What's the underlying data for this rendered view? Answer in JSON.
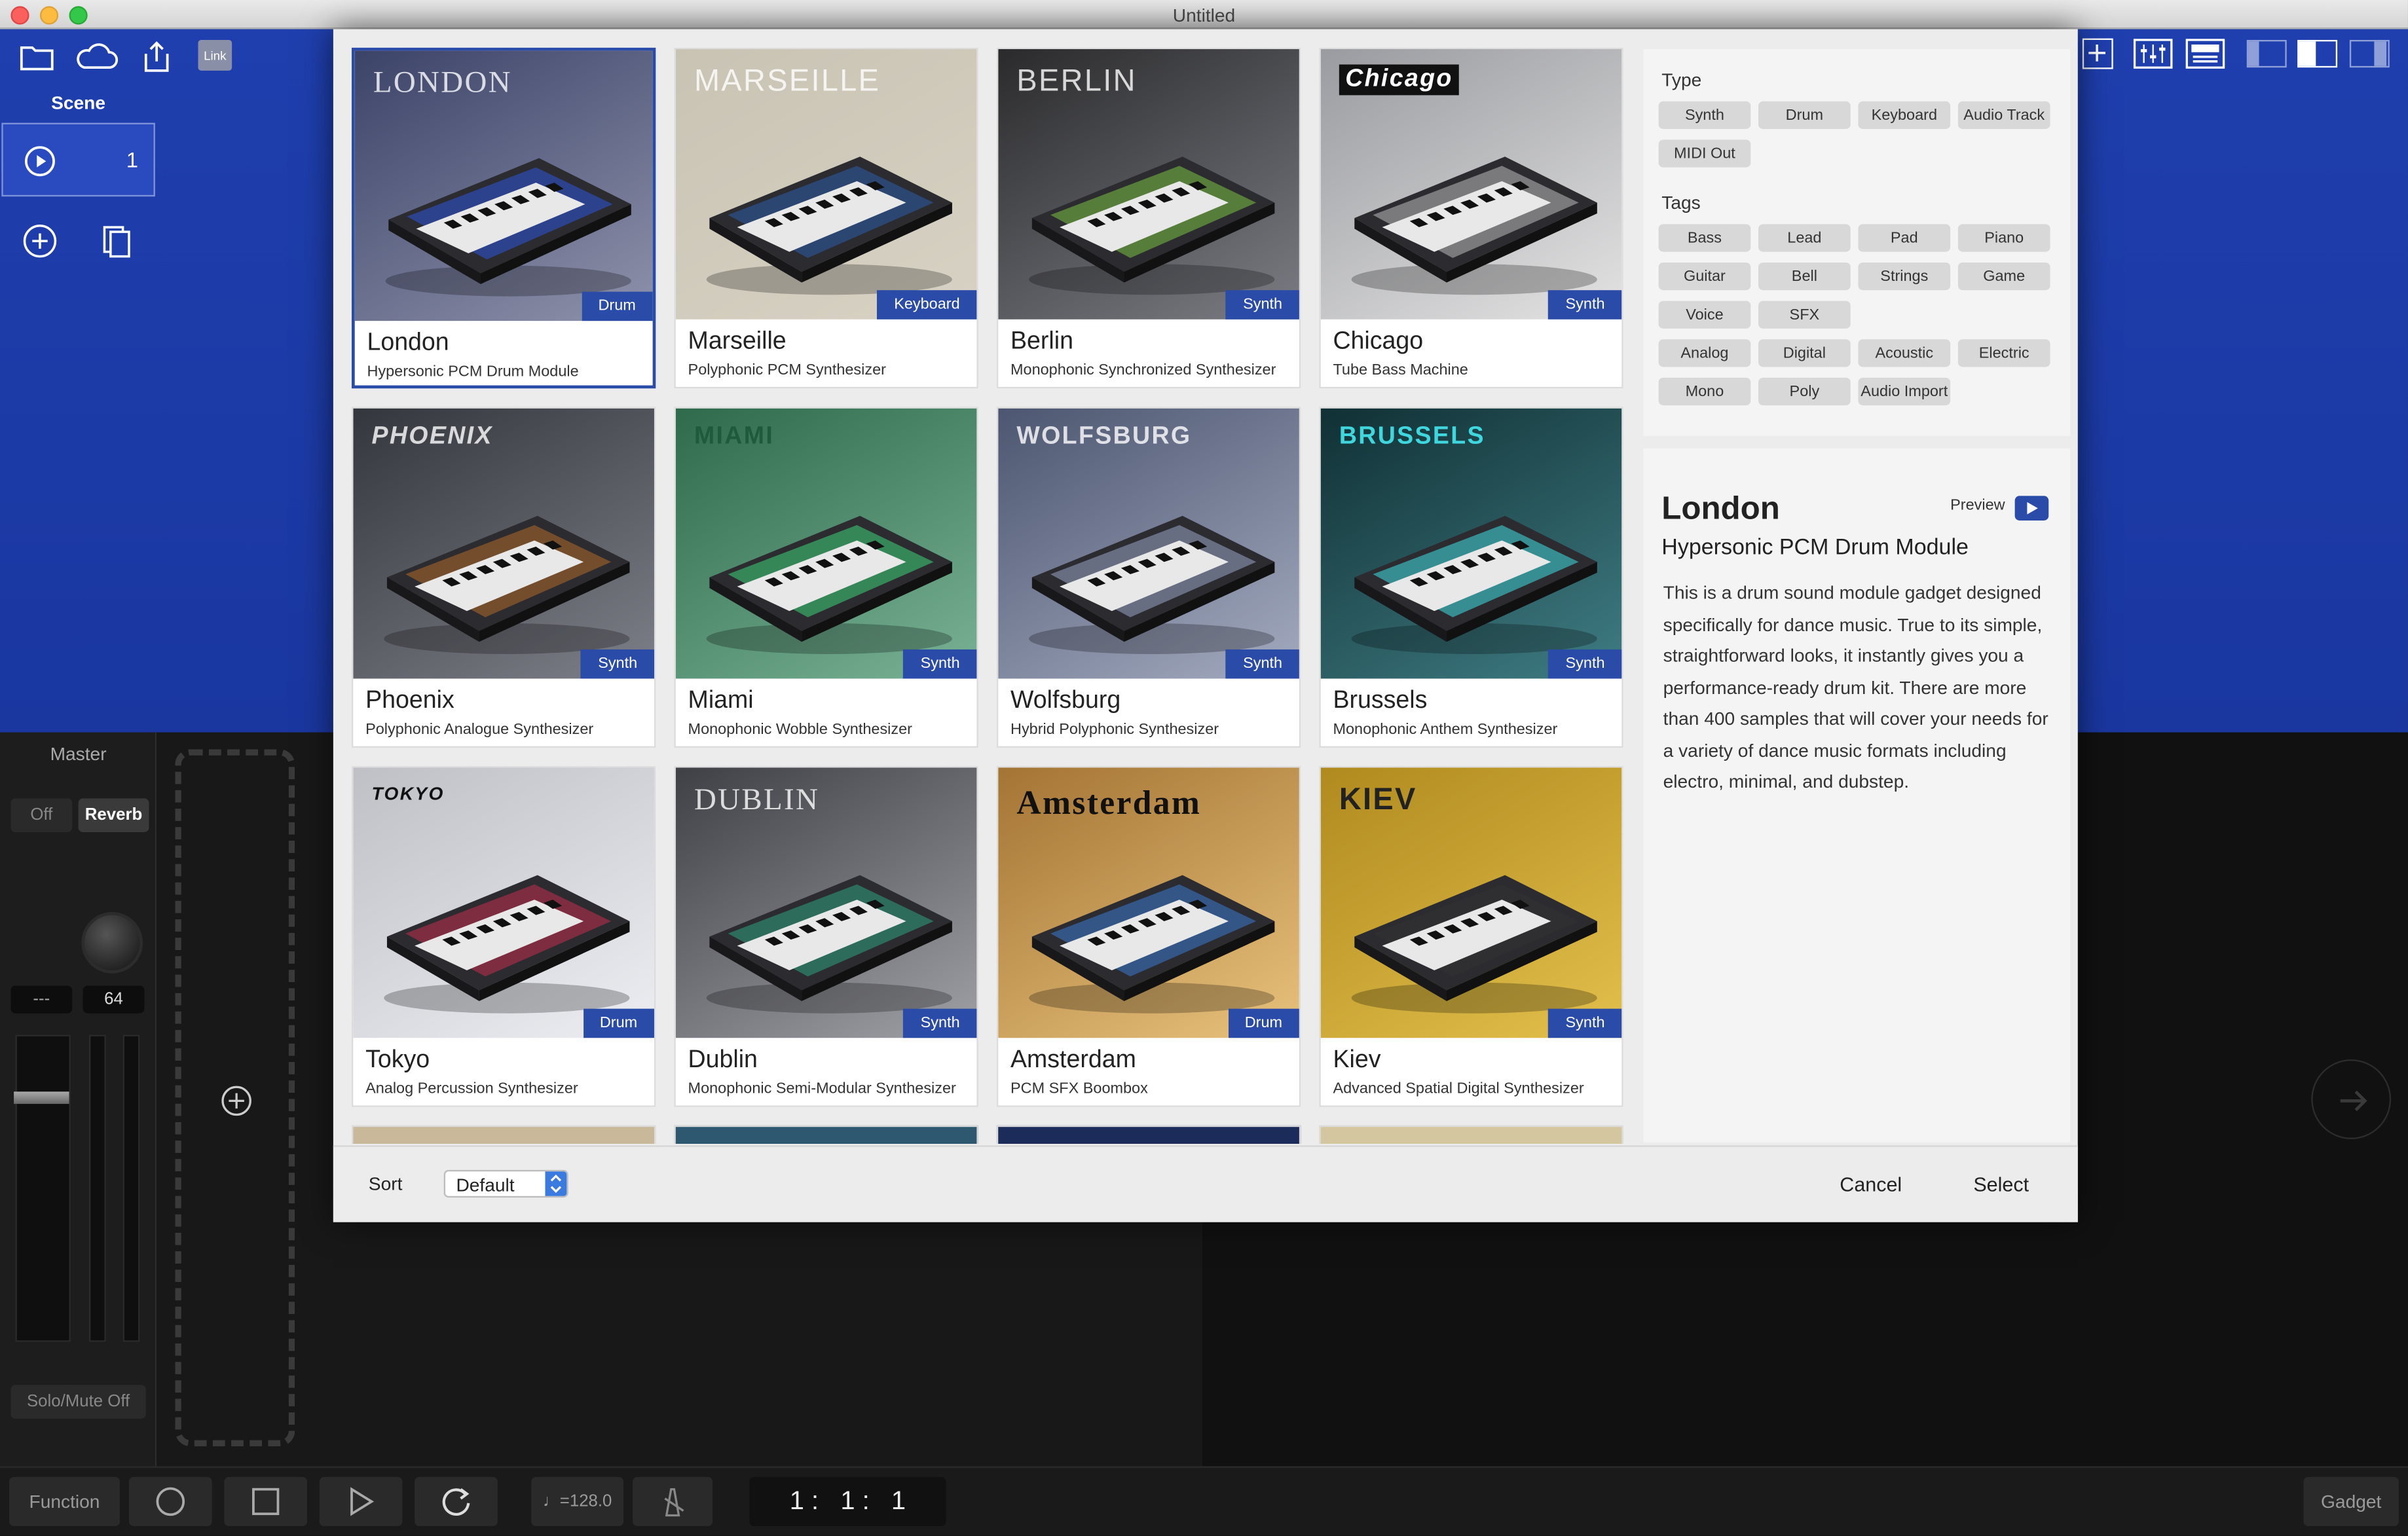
{
  "window": {
    "title": "Untitled"
  },
  "toolbar": {
    "link_label": "Link"
  },
  "scene": {
    "label": "Scene",
    "number": "1"
  },
  "master": {
    "label": "Master",
    "off_label": "Off",
    "reverb_label": "Reverb",
    "left_value": "---",
    "right_value": "64",
    "solo_mute_label": "Solo/Mute Off"
  },
  "transport": {
    "function_label": "Function",
    "tempo": "♩=128.0",
    "position": "1 :   1 :   1",
    "gadget_label": "Gadget"
  },
  "gadgets": [
    {
      "logo": "LONDON",
      "type": "Drum",
      "name": "London",
      "desc": "Hypersonic PCM Drum Module",
      "bg1": "#3b4368",
      "bg2": "#8f92ab",
      "accent": "#2f55d9"
    },
    {
      "logo": "MARSEILLE",
      "type": "Keyboard",
      "name": "Marseille",
      "desc": "Polyphonic PCM Synthesizer",
      "bg1": "#c9c3b4",
      "bg2": "#d8d2c4",
      "accent": "#2a5da8"
    },
    {
      "logo": "BERLIN",
      "type": "Synth",
      "name": "Berlin",
      "desc": "Monophonic Synchronized Synthesizer",
      "bg1": "#2a2a2c",
      "bg2": "#7b7d84",
      "accent": "#7ac142"
    },
    {
      "logo": "Chicago",
      "type": "Synth",
      "name": "Chicago",
      "desc": "Tube Bass Machine",
      "bg1": "#9a9ba0",
      "bg2": "#e3e3e3",
      "accent": "#bbbbbb"
    },
    {
      "logo": "PHOENIX",
      "type": "Synth",
      "name": "Phoenix",
      "desc": "Polyphonic Analogue Synthesizer",
      "bg1": "#34363d",
      "bg2": "#7e8089",
      "accent": "#b06a2a"
    },
    {
      "logo": "MIAMI",
      "type": "Synth",
      "name": "Miami",
      "desc": "Monophonic Wobble Synthesizer",
      "bg1": "#2f6a4c",
      "bg2": "#79b295",
      "accent": "#3fd47a"
    },
    {
      "logo": "WOLFSBURG",
      "type": "Synth",
      "name": "Wolfsburg",
      "desc": "Hybrid Polyphonic Synthesizer",
      "bg1": "#4c5670",
      "bg2": "#a4abc0",
      "accent": "#9aa6c6"
    },
    {
      "logo": "BRUSSELS",
      "type": "Synth",
      "name": "Brussels",
      "desc": "Monophonic Anthem Synthesizer",
      "bg1": "#103034",
      "bg2": "#3f7d84",
      "accent": "#3fe0e6"
    },
    {
      "logo": "TOKYO",
      "type": "Drum",
      "name": "Tokyo",
      "desc": "Analog Percussion Synthesizer",
      "bg1": "#bfc0c6",
      "bg2": "#eceef2",
      "accent": "#c32f4f"
    },
    {
      "logo": "DUBLIN",
      "type": "Synth",
      "name": "Dublin",
      "desc": "Monophonic Semi-Modular Synthesizer",
      "bg1": "#3f4045",
      "bg2": "#a0a1a6",
      "accent": "#2fa080"
    },
    {
      "logo": "Amsterdam",
      "type": "Drum",
      "name": "Amsterdam",
      "desc": "PCM SFX Boombox",
      "bg1": "#a47434",
      "bg2": "#e8c27c",
      "accent": "#3a7ad0"
    },
    {
      "logo": "KIEV",
      "type": "Synth",
      "name": "Kiev",
      "desc": "Advanced Spatial Digital Synthesizer",
      "bg1": "#b08a1e",
      "bg2": "#e3c04c",
      "accent": "#333333"
    }
  ],
  "filters": {
    "type_label": "Type",
    "types": [
      "Synth",
      "Drum",
      "Keyboard",
      "Audio Track",
      "MIDI Out"
    ],
    "tags_label": "Tags",
    "tags": [
      "Bass",
      "Lead",
      "Pad",
      "Piano",
      "Guitar",
      "Bell",
      "Strings",
      "Game",
      "Voice",
      "SFX",
      "Analog",
      "Digital",
      "Acoustic",
      "Electric",
      "Mono",
      "Poly",
      "Audio Import"
    ]
  },
  "detail": {
    "name": "London",
    "subtitle": "Hypersonic PCM Drum Module",
    "preview_label": "Preview",
    "description": "This is a drum sound module gadget designed specifically for dance music. True to its simple, straightforward looks, it instantly gives you a performance-ready drum kit. There are more than 400 samples that will cover your needs for a variety of dance music formats including electro, minimal, and dubstep."
  },
  "footer": {
    "sort_label": "Sort",
    "sort_value": "Default",
    "cancel_label": "Cancel",
    "select_label": "Select"
  }
}
